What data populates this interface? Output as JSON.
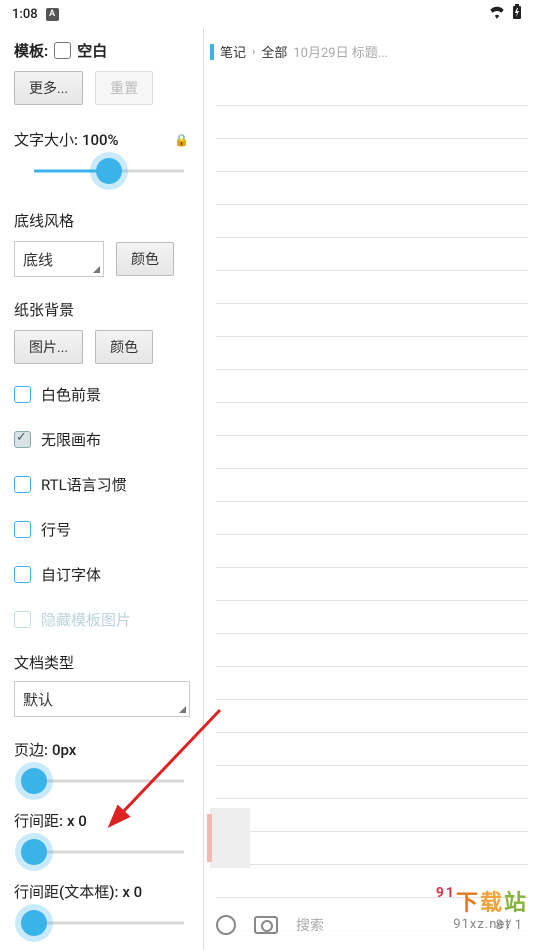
{
  "statusbar": {
    "time": "1:08",
    "badge": "A"
  },
  "template": {
    "label": "模板:",
    "blank_label": "空白",
    "more_btn": "更多...",
    "reset_btn": "重置"
  },
  "font_size": {
    "label": "文字大小:",
    "value": "100%"
  },
  "underline_style": {
    "heading": "底线风格",
    "value": "底线",
    "color_btn": "颜色"
  },
  "paper_bg": {
    "heading": "纸张背景",
    "image_btn": "图片...",
    "color_btn": "颜色"
  },
  "checks": {
    "white_fg": "白色前景",
    "infinite_canvas": "无限画布",
    "rtl": "RTL语言习惯",
    "line_number": "行号",
    "custom_font": "自订字体",
    "hide_template_img": "隐藏模板图片"
  },
  "doc_type": {
    "heading": "文档类型",
    "value": "默认"
  },
  "margin": {
    "label": "页边:",
    "value": "0px"
  },
  "line_spacing": {
    "label": "行间距:",
    "value": "x 0"
  },
  "line_spacing_tb": {
    "label": "行间距(文本框):",
    "value": "x 0"
  },
  "breadcrumb": {
    "a": "笔记",
    "b": "全部",
    "date": "10月29日 标题..."
  },
  "bottombar": {
    "search": "搜索",
    "page": "8 / 1"
  },
  "watermark": {
    "cn1": "下",
    "cn2": "载",
    "cn3": "站",
    "en": "91xz.net"
  }
}
